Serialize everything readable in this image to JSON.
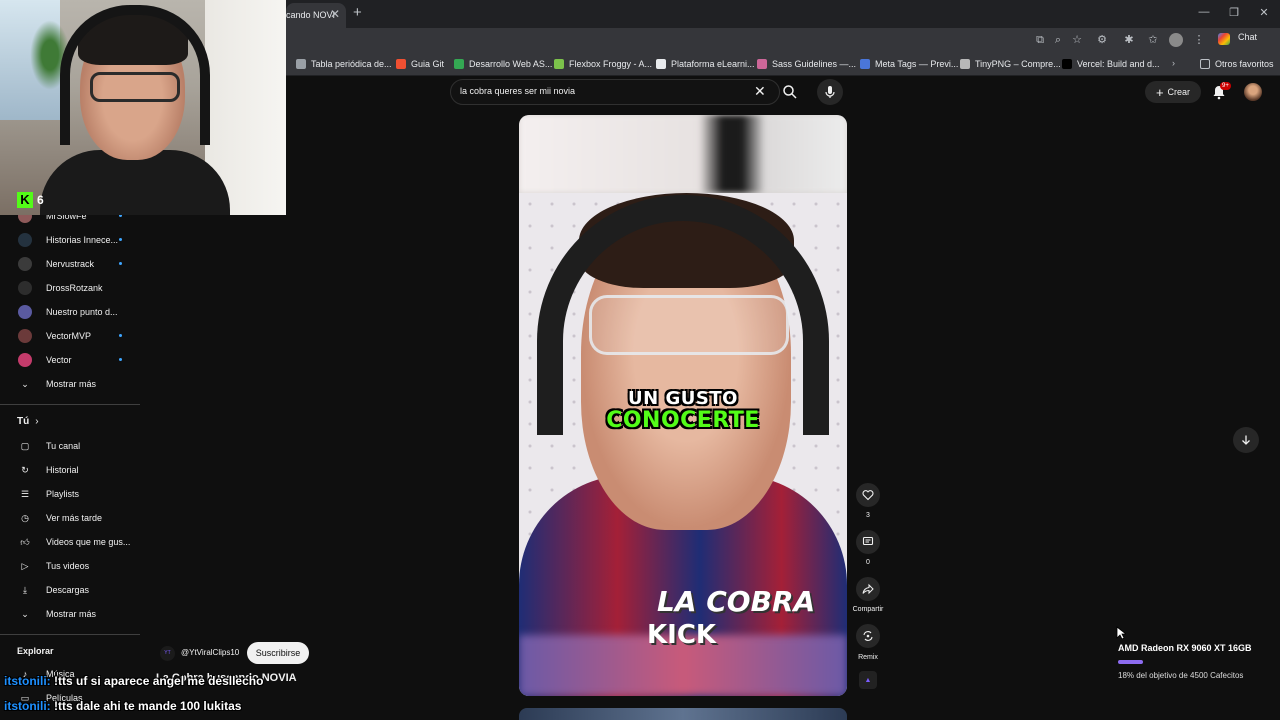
{
  "browser": {
    "tab_title": "cando NOVI",
    "chat_label": "Chat",
    "bookmarks": [
      {
        "label": "Tabla periódica de...",
        "color": "#9aa0a6"
      },
      {
        "label": "Guia Git",
        "color": "#f05032"
      },
      {
        "label": "Desarrollo Web AS...",
        "color": "#34a853"
      },
      {
        "label": "Flexbox Froggy - A...",
        "color": "#7cc24b"
      },
      {
        "label": "Plataforma eLearni...",
        "color": "#e8eaed"
      },
      {
        "label": "Sass Guidelines —...",
        "color": "#cd6799"
      },
      {
        "label": "Meta Tags — Previ...",
        "color": "#4a76d9"
      },
      {
        "label": "TinyPNG – Compre...",
        "color": "#b8b8b8"
      },
      {
        "label": "Vercel: Build and d...",
        "color": "#000000"
      }
    ],
    "other_favorites": "Otros favoritos"
  },
  "youtube": {
    "search_value": "la cobra queres ser mii novia",
    "create_label": "Crear",
    "notif_count": "9+",
    "sidebar": {
      "subscriptions": [
        {
          "label": "MrSlowFe",
          "live": true,
          "color": "#8e5a5a"
        },
        {
          "label": "Historias Innece...",
          "live": true,
          "color": "#24323f"
        },
        {
          "label": "Nervustrack",
          "live": true,
          "color": "#3b3b3b"
        },
        {
          "label": "DrossRotzank",
          "live": false,
          "color": "#2d2d2d"
        },
        {
          "label": "Nuestro punto d...",
          "live": false,
          "color": "#5a5aa0"
        },
        {
          "label": "VectorMVP",
          "live": true,
          "color": "#6b3a3a"
        },
        {
          "label": "Vector",
          "live": true,
          "color": "#c43b6b"
        }
      ],
      "show_more_1": "Mostrar más",
      "you_header": "Tú",
      "you_items": [
        {
          "label": "Tu canal",
          "icon": "channel-icon"
        },
        {
          "label": "Historial",
          "icon": "history-icon"
        },
        {
          "label": "Playlists",
          "icon": "playlist-icon"
        },
        {
          "label": "Ver más tarde",
          "icon": "clock-icon"
        },
        {
          "label": "Videos que me gus...",
          "icon": "like-icon"
        },
        {
          "label": "Tus videos",
          "icon": "video-icon"
        },
        {
          "label": "Descargas",
          "icon": "download-icon"
        }
      ],
      "show_more_2": "Mostrar más",
      "explore_header": "Explorar",
      "explore_items": [
        {
          "label": "Música",
          "icon": "music-icon"
        },
        {
          "label": "Películas",
          "icon": "movie-icon"
        }
      ]
    },
    "short": {
      "caption_line1": "UN GUSTO",
      "caption_line2": "CONOCERTE",
      "logo_line1": "LA COBRA",
      "logo_line2": "KICK",
      "likes": "3",
      "comments": "0",
      "share_label": "Compartir",
      "remix_label": "Remix",
      "channel_handle": "@YtViralClips10",
      "subscribe_label": "Suscribirse",
      "title": "La Cobra buscando NOVIA"
    }
  },
  "stream_overlay": {
    "kick_viewers": "6",
    "chat": [
      {
        "user": "itstonili:",
        "message": "!tts uf si aparece angel me desllecho"
      },
      {
        "user": "itstonili:",
        "message": "!tts dale ahi te mande 100 lukitas"
      }
    ],
    "goal_title": "AMD Radeon RX 9060 XT 16GB",
    "goal_progress_percent": 18,
    "goal_text": "18% del objetivo de 4500 Cafecitos"
  }
}
